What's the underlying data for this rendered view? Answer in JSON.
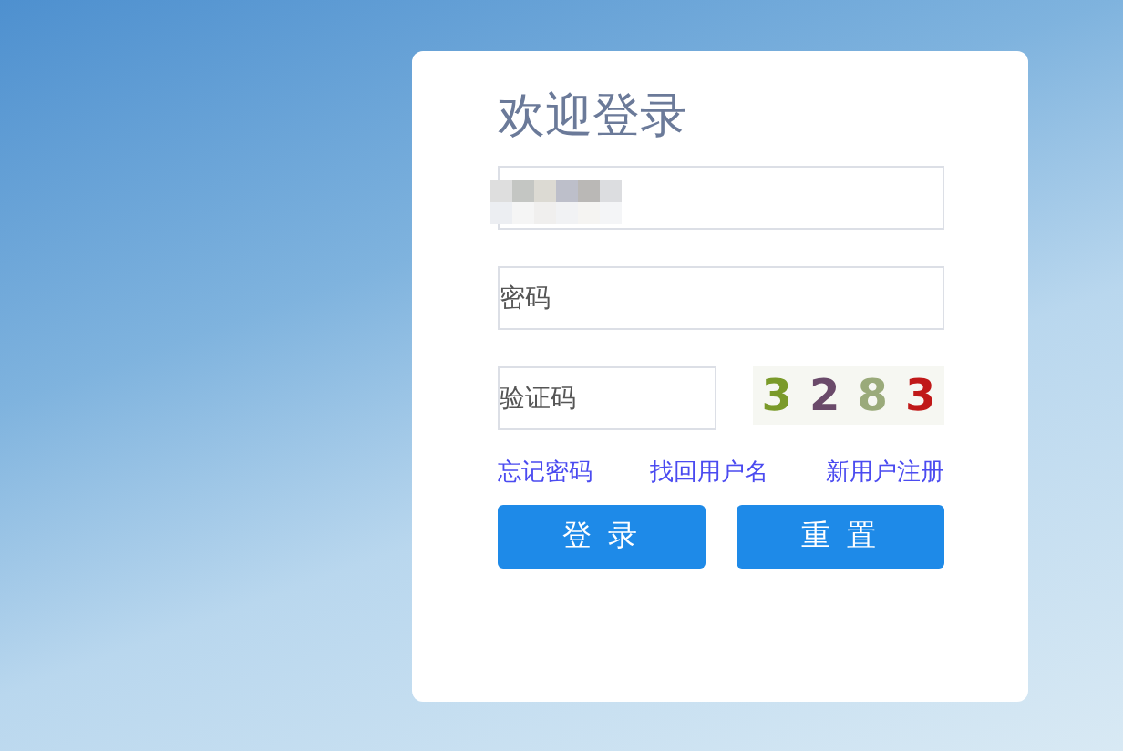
{
  "title": "欢迎登录",
  "username": {
    "redacted": true
  },
  "password": {
    "placeholder": "密码"
  },
  "captcha_field": {
    "placeholder": "验证码"
  },
  "captcha_image": {
    "chars": [
      {
        "text": "3",
        "color": "#7a9a2a"
      },
      {
        "text": "2",
        "color": "#6a4a6a"
      },
      {
        "text": "8",
        "color": "#9aaa7a"
      },
      {
        "text": "3",
        "color": "#c01818"
      }
    ]
  },
  "links": [
    "忘记密码",
    "找回用户名",
    "新用户注册"
  ],
  "buttons": [
    "登 录",
    "重 置"
  ]
}
